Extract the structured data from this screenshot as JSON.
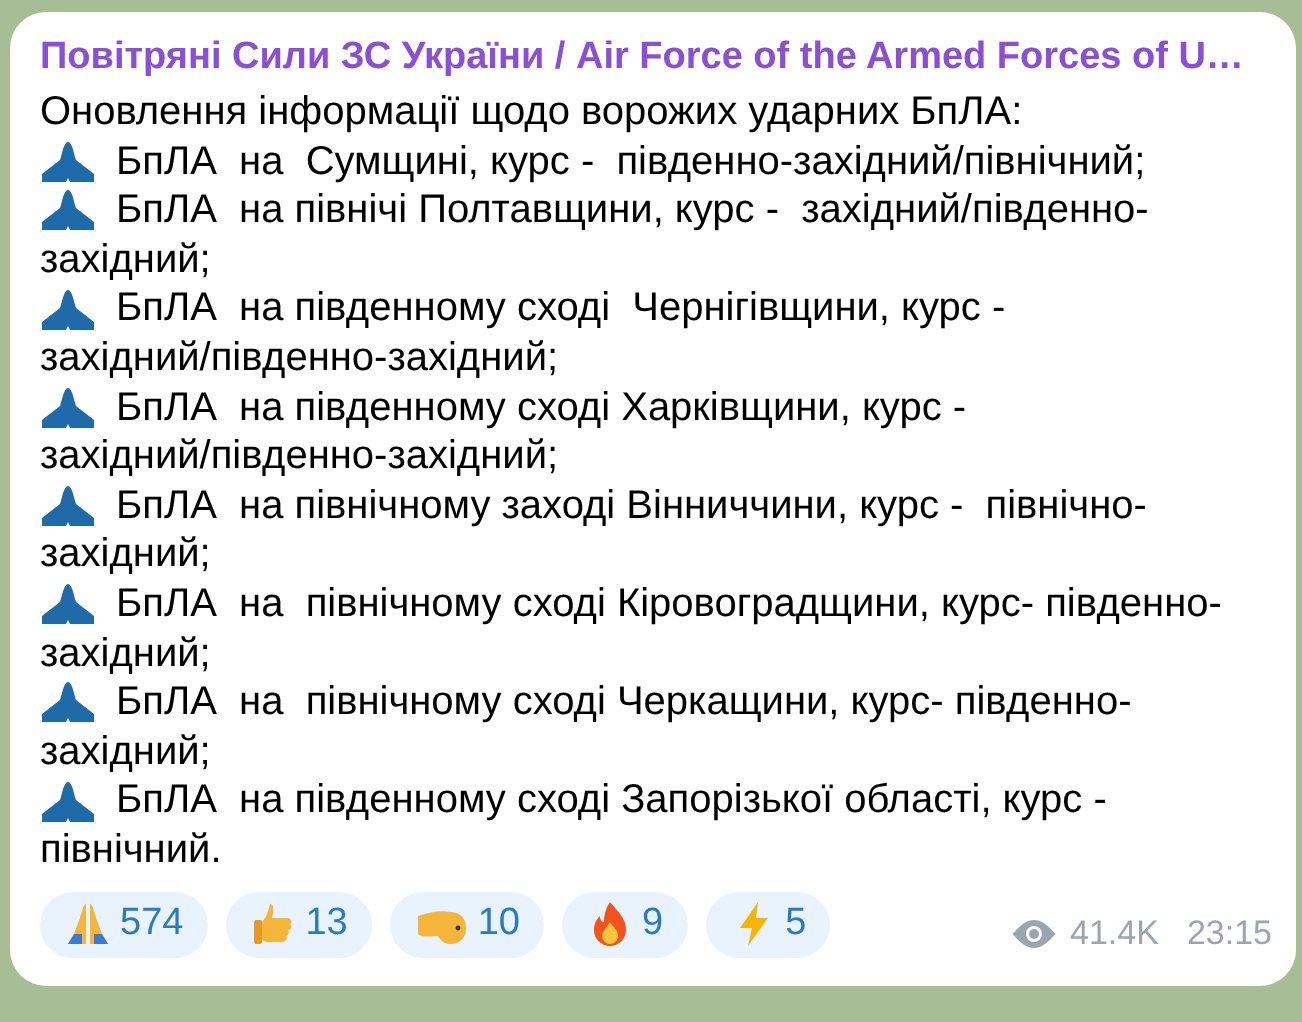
{
  "message": {
    "channel": "Повітряні Сили ЗС України / Air Force of the Armed Forces of U…",
    "intro": "Оновлення інформації щодо ворожих ударних БпЛА:",
    "items": [
      {
        "kind": "drone",
        "lines": [
          "БпЛА  на  Сумщині, курс -  південно-західний/північний;"
        ]
      },
      {
        "kind": "drone",
        "lines": [
          "БпЛА  на північі Полтавщини, курс -  західний/південно-",
          "західний;"
        ]
      },
      {
        "kind": "drone",
        "lines": [
          "БпЛА  на південному сході  Чернігівщини, курс -",
          "західний/південно-західний;"
        ]
      },
      {
        "kind": "drone",
        "lines": [
          "БпЛА  на південному сході Харківщини, курс -",
          "західний/південно-західний;"
        ]
      },
      {
        "kind": "drone",
        "lines": [
          "БпЛА  на північному заході Вінниччини, курс -  північно-",
          "західний;"
        ]
      },
      {
        "kind": "drone",
        "lines": [
          "БпЛА  на  північному сході Кіровоградщини, курс- південно-",
          "західний;"
        ]
      },
      {
        "kind": "drone",
        "lines": [
          "БпЛА  на  північному сході Черкащини, курс- південно-",
          "західний;"
        ]
      },
      {
        "kind": "drone",
        "lines": [
          "БпЛА  на південному сході Запорізької області, курс -",
          "північний."
        ]
      }
    ],
    "reactions": [
      {
        "kind": "pray",
        "count": "574"
      },
      {
        "kind": "thumbs",
        "count": "13"
      },
      {
        "kind": "point",
        "count": "10"
      },
      {
        "kind": "fire",
        "count": "9"
      },
      {
        "kind": "bolt",
        "count": "5"
      }
    ],
    "views": "41.4K",
    "time": "23:15"
  }
}
